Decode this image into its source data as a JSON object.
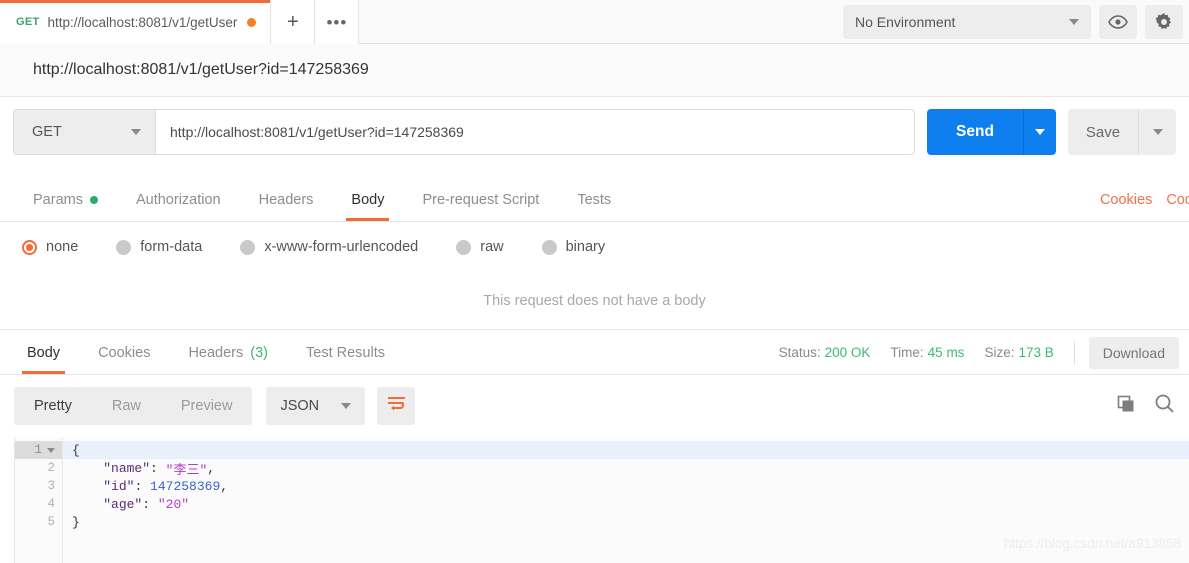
{
  "topbar": {
    "tab": {
      "method": "GET",
      "url": "http://localhost:8081/v1/getUser",
      "unsaved_icon": "unsaved-dot"
    },
    "new_tab_label": "+",
    "more_label": "•••",
    "environment": {
      "selected": "No Environment",
      "caret_icon": "chevron-down-icon"
    },
    "eye_icon": "eye-icon",
    "gear_icon": "gear-icon"
  },
  "request": {
    "title": "http://localhost:8081/v1/getUser?id=147258369",
    "method": "GET",
    "url_value": "http://localhost:8081/v1/getUser?id=147258369",
    "send_label": "Send",
    "save_label": "Save",
    "tabs": [
      {
        "label": "Params",
        "badge": "dot",
        "active": false
      },
      {
        "label": "Authorization",
        "badge": "",
        "active": false
      },
      {
        "label": "Headers",
        "badge": "",
        "active": false
      },
      {
        "label": "Body",
        "badge": "",
        "active": true
      },
      {
        "label": "Pre-request Script",
        "badge": "",
        "active": false
      },
      {
        "label": "Tests",
        "badge": "",
        "active": false
      }
    ],
    "links": {
      "cookies": "Cookies",
      "code": "Code"
    },
    "body_types": [
      {
        "label": "none",
        "checked": true
      },
      {
        "label": "form-data",
        "checked": false
      },
      {
        "label": "x-www-form-urlencoded",
        "checked": false
      },
      {
        "label": "raw",
        "checked": false
      },
      {
        "label": "binary",
        "checked": false
      }
    ],
    "empty_body_message": "This request does not have a body"
  },
  "response": {
    "tabs": [
      {
        "label": "Body",
        "count": "",
        "active": true
      },
      {
        "label": "Cookies",
        "count": "",
        "active": false
      },
      {
        "label": "Headers",
        "count": "(3)",
        "active": false
      },
      {
        "label": "Test Results",
        "count": "",
        "active": false
      }
    ],
    "status_label": "Status:",
    "status_value": "200 OK",
    "time_label": "Time:",
    "time_value": "45 ms",
    "size_label": "Size:",
    "size_value": "173 B",
    "download_label": "Download",
    "format_tabs": [
      {
        "label": "Pretty",
        "active": true
      },
      {
        "label": "Raw",
        "active": false
      },
      {
        "label": "Preview",
        "active": false
      }
    ],
    "language": "JSON",
    "wrap_icon": "word-wrap-icon",
    "copy_icon": "copy-icon",
    "search_icon": "search-icon",
    "body_lines": [
      {
        "n": "1",
        "foldable": true,
        "highlight": true,
        "tokens": [
          {
            "t": "{",
            "c": "k-punc"
          }
        ]
      },
      {
        "n": "2",
        "foldable": false,
        "highlight": false,
        "tokens": [
          {
            "t": "    ",
            "c": "k-punc"
          },
          {
            "t": "\"name\"",
            "c": "k-key"
          },
          {
            "t": ": ",
            "c": "k-punc"
          },
          {
            "t": "\"李三\"",
            "c": "k-str"
          },
          {
            "t": ",",
            "c": "k-punc"
          }
        ]
      },
      {
        "n": "3",
        "foldable": false,
        "highlight": false,
        "tokens": [
          {
            "t": "    ",
            "c": "k-punc"
          },
          {
            "t": "\"id\"",
            "c": "k-key"
          },
          {
            "t": ": ",
            "c": "k-punc"
          },
          {
            "t": "147258369",
            "c": "k-num"
          },
          {
            "t": ",",
            "c": "k-punc"
          }
        ]
      },
      {
        "n": "4",
        "foldable": false,
        "highlight": false,
        "tokens": [
          {
            "t": "    ",
            "c": "k-punc"
          },
          {
            "t": "\"age\"",
            "c": "k-key"
          },
          {
            "t": ": ",
            "c": "k-punc"
          },
          {
            "t": "\"20\"",
            "c": "k-str"
          }
        ]
      },
      {
        "n": "5",
        "foldable": false,
        "highlight": false,
        "tokens": [
          {
            "t": "}",
            "c": "k-punc"
          }
        ]
      }
    ]
  },
  "watermark": "https://blog.csdn.net/a913858",
  "colors": {
    "accent_orange": "#f26b3a",
    "send_blue": "#0f7ff0",
    "status_green": "#3cb878",
    "method_green": "#3ca372"
  }
}
